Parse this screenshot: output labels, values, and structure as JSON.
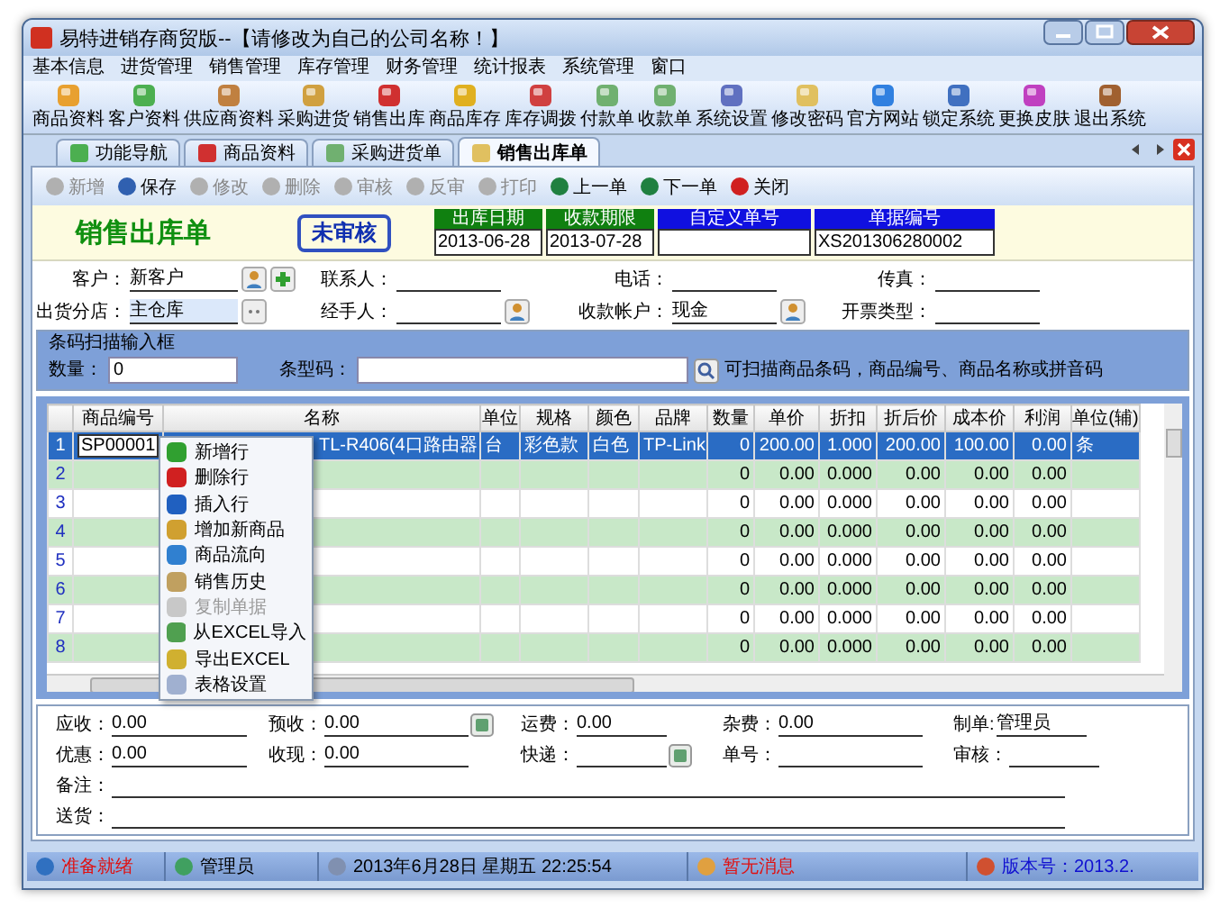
{
  "window": {
    "title": "易特进销存商贸版--【请修改为自己的公司名称！】"
  },
  "menu": [
    "基本信息",
    "进货管理",
    "销售管理",
    "库存管理",
    "财务管理",
    "统计报表",
    "系统管理",
    "窗口"
  ],
  "toolbar": [
    "商品资料",
    "客户资料",
    "供应商资料",
    "采购进货",
    "销售出库",
    "商品库存",
    "库存调拨",
    "付款单",
    "收款单",
    "系统设置",
    "修改密码",
    "官方网站",
    "锁定系统",
    "更换皮肤",
    "退出系统"
  ],
  "tabs": [
    {
      "label": "功能导航",
      "selected": false
    },
    {
      "label": "商品资料",
      "selected": false
    },
    {
      "label": "采购进货单",
      "selected": false
    },
    {
      "label": "销售出库单",
      "selected": true
    }
  ],
  "actions": [
    {
      "label": "新增",
      "disabled": true
    },
    {
      "label": "保存",
      "disabled": false
    },
    {
      "label": "修改",
      "disabled": true
    },
    {
      "label": "删除",
      "disabled": true
    },
    {
      "label": "审核",
      "disabled": true
    },
    {
      "label": "反审",
      "disabled": true
    },
    {
      "label": "打印",
      "disabled": true
    },
    {
      "label": "上一单",
      "disabled": false
    },
    {
      "label": "下一单",
      "disabled": false
    },
    {
      "label": "关闭",
      "disabled": false
    }
  ],
  "header": {
    "title": "销售出库单",
    "status": "未审核",
    "fields": [
      {
        "label": "出库日期",
        "value": "2013-06-28",
        "color": "#108010"
      },
      {
        "label": "收款期限",
        "value": "2013-07-28",
        "color": "#108010"
      },
      {
        "label": "自定义单号",
        "color": "#1010e0"
      },
      {
        "label": "单据编号",
        "value": "XS201306280002",
        "color": "#1010e0"
      }
    ]
  },
  "form": [
    [
      {
        "label": "客户：",
        "value": "新客户",
        "kind": "lookup_add"
      },
      {
        "label": "联系人：",
        "kind": "plain"
      },
      {
        "label": "电话：",
        "kind": "plain"
      },
      {
        "label": "传真：",
        "kind": "plain"
      }
    ],
    [
      {
        "label": "出货分店：",
        "value": "主仓库",
        "kind": "branch"
      },
      {
        "label": "经手人：",
        "kind": "lookup"
      },
      {
        "label": "收款帐户：",
        "value": "现金",
        "kind": "lookup"
      },
      {
        "label": "开票类型：",
        "kind": "plain"
      }
    ]
  ],
  "barcode": {
    "title": "条码扫描输入框",
    "qty_label": "数量：",
    "qty": "0",
    "code_label": "条型码：",
    "hint": "可扫描商品条码，商品编号、商品名称或拼音码"
  },
  "grid": {
    "columns": [
      "商品编号",
      "名称",
      "单位",
      "规格",
      "颜色",
      "品牌",
      "数量",
      "单价",
      "折扣",
      "折后价",
      "成本价",
      "利润",
      "单位(辅)"
    ],
    "rows": [
      {
        "num": "1",
        "selected": true,
        "cells": [
          "SP00001",
          "TL-R406(4口路由器",
          "台",
          "彩色款",
          "白色",
          "TP-Link",
          "0",
          "200.00",
          "1.000",
          "200.00",
          "100.00",
          "0.00",
          "条"
        ]
      },
      {
        "num": "2",
        "selected": false,
        "cells": [
          "",
          "",
          "",
          "",
          "",
          "",
          "0",
          "0.00",
          "0.000",
          "0.00",
          "0.00",
          "0.00",
          ""
        ]
      },
      {
        "num": "3",
        "selected": false,
        "cells": [
          "",
          "",
          "",
          "",
          "",
          "",
          "0",
          "0.00",
          "0.000",
          "0.00",
          "0.00",
          "0.00",
          ""
        ]
      },
      {
        "num": "4",
        "selected": false,
        "cells": [
          "",
          "",
          "",
          "",
          "",
          "",
          "0",
          "0.00",
          "0.000",
          "0.00",
          "0.00",
          "0.00",
          ""
        ]
      },
      {
        "num": "5",
        "selected": false,
        "cells": [
          "",
          "",
          "",
          "",
          "",
          "",
          "0",
          "0.00",
          "0.000",
          "0.00",
          "0.00",
          "0.00",
          ""
        ]
      },
      {
        "num": "6",
        "selected": false,
        "cells": [
          "",
          "",
          "",
          "",
          "",
          "",
          "0",
          "0.00",
          "0.000",
          "0.00",
          "0.00",
          "0.00",
          ""
        ]
      },
      {
        "num": "7",
        "selected": false,
        "cells": [
          "",
          "",
          "",
          "",
          "",
          "",
          "0",
          "0.00",
          "0.000",
          "0.00",
          "0.00",
          "0.00",
          ""
        ]
      },
      {
        "num": "8",
        "selected": false,
        "cells": [
          "",
          "",
          "",
          "",
          "",
          "",
          "0",
          "0.00",
          "0.000",
          "0.00",
          "0.00",
          "0.00",
          ""
        ]
      }
    ]
  },
  "context_menu": [
    {
      "label": "新增行",
      "disabled": false
    },
    {
      "label": "删除行",
      "disabled": false
    },
    {
      "label": "插入行",
      "disabled": false
    },
    {
      "label": "增加新商品",
      "disabled": false
    },
    {
      "label": "商品流向",
      "disabled": false
    },
    {
      "label": "销售历史",
      "disabled": false
    },
    {
      "label": "复制单据",
      "disabled": true
    },
    {
      "label": "从EXCEL导入",
      "disabled": false
    },
    {
      "label": "导出EXCEL",
      "disabled": false
    },
    {
      "label": "表格设置",
      "disabled": false
    }
  ],
  "summary": [
    [
      {
        "label": "应收：",
        "value": "0.00",
        "kind": "plain"
      },
      {
        "label": "预收：",
        "value": "0.00",
        "kind": "lookup"
      },
      {
        "label": "运费：",
        "value": "0.00",
        "kind": "plain"
      },
      {
        "label": "杂费：",
        "value": "0.00",
        "kind": "plain"
      },
      {
        "label": "制单:",
        "value": "管理员",
        "kind": "plain"
      }
    ],
    [
      {
        "label": "优惠：",
        "value": "0.00",
        "kind": "plain"
      },
      {
        "label": "收现：",
        "value": "0.00",
        "kind": "plain"
      },
      {
        "label": "快递：",
        "kind": "lookup"
      },
      {
        "label": "单号：",
        "kind": "plain"
      },
      {
        "label": "审核：",
        "kind": "plain"
      }
    ],
    [
      {
        "label": "备注：",
        "kind": "wide"
      }
    ],
    [
      {
        "label": "送货：",
        "kind": "wide"
      }
    ]
  ],
  "status_bar": [
    {
      "text": "准备就绪",
      "color": "#e01010"
    },
    {
      "text": "管理员",
      "color": "#000000"
    },
    {
      "text": "2013年6月28日   星期五     22:25:54",
      "color": "#000000"
    },
    {
      "text": "暂无消息",
      "color": "#e01010"
    },
    {
      "text": "版本号：2013.2.",
      "color": "#1010d0"
    }
  ]
}
